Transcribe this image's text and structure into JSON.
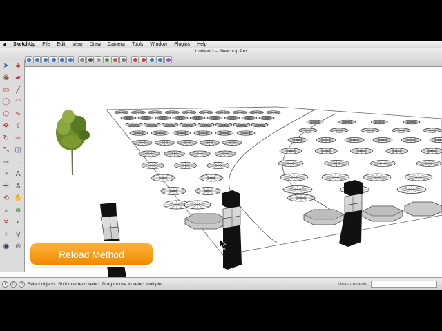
{
  "menubar": {
    "apple": "",
    "app_name": "SketchUp",
    "items": [
      "File",
      "Edit",
      "View",
      "Draw",
      "Camera",
      "Tools",
      "Window",
      "Plugins",
      "Help"
    ]
  },
  "window": {
    "title": "Untitled 2 – SketchUp Pro"
  },
  "toolbar": {
    "icons": [
      "iso-view-icon",
      "top-view-icon",
      "front-view-icon",
      "right-view-icon",
      "back-view-icon",
      "left-view-icon",
      "xray-icon",
      "wireframe-icon",
      "hidden-line-icon",
      "shaded-icon",
      "textured-icon",
      "monochrome-icon",
      "component-icon",
      "warehouse-icon",
      "upload-icon",
      "share-icon",
      "extension-icon"
    ]
  },
  "palette": {
    "tools": [
      [
        "select-arrow-icon",
        "make-component-icon"
      ],
      [
        "paint-bucket-icon",
        "eraser-icon"
      ],
      [
        "rectangle-icon",
        "line-icon"
      ],
      [
        "circle-icon",
        "arc-icon"
      ],
      [
        "polygon-icon",
        "freehand-icon"
      ],
      [
        "move-icon",
        "push-pull-icon"
      ],
      [
        "rotate-icon",
        "follow-me-icon"
      ],
      [
        "scale-icon",
        "offset-icon"
      ],
      [
        "tape-measure-icon",
        "dimension-icon"
      ],
      [
        "protractor-icon",
        "text-icon"
      ],
      [
        "axes-icon",
        "3d-text-icon"
      ],
      [
        "orbit-icon",
        "pan-icon"
      ],
      [
        "zoom-icon",
        "zoom-window-icon"
      ],
      [
        "zoom-extents-icon",
        "previous-view-icon"
      ],
      [
        "position-camera-icon",
        "walk-icon"
      ],
      [
        "look-around-icon",
        "section-plane-icon"
      ]
    ]
  },
  "overlay": {
    "label": "Reload Method"
  },
  "statusbar": {
    "icons": [
      "info-icon",
      "geo-icon",
      "help-icon"
    ],
    "message": "Select objects. Shift to extend select. Drag mouse to select multiple.",
    "measurements_label": "Measurements",
    "measurements_value": ""
  },
  "colors": {
    "accent_orange": "#f39200",
    "menubar_bg": "#e6e6e6",
    "viewport_bg": "#ffffff",
    "tree_green": "#6b8a2a"
  }
}
